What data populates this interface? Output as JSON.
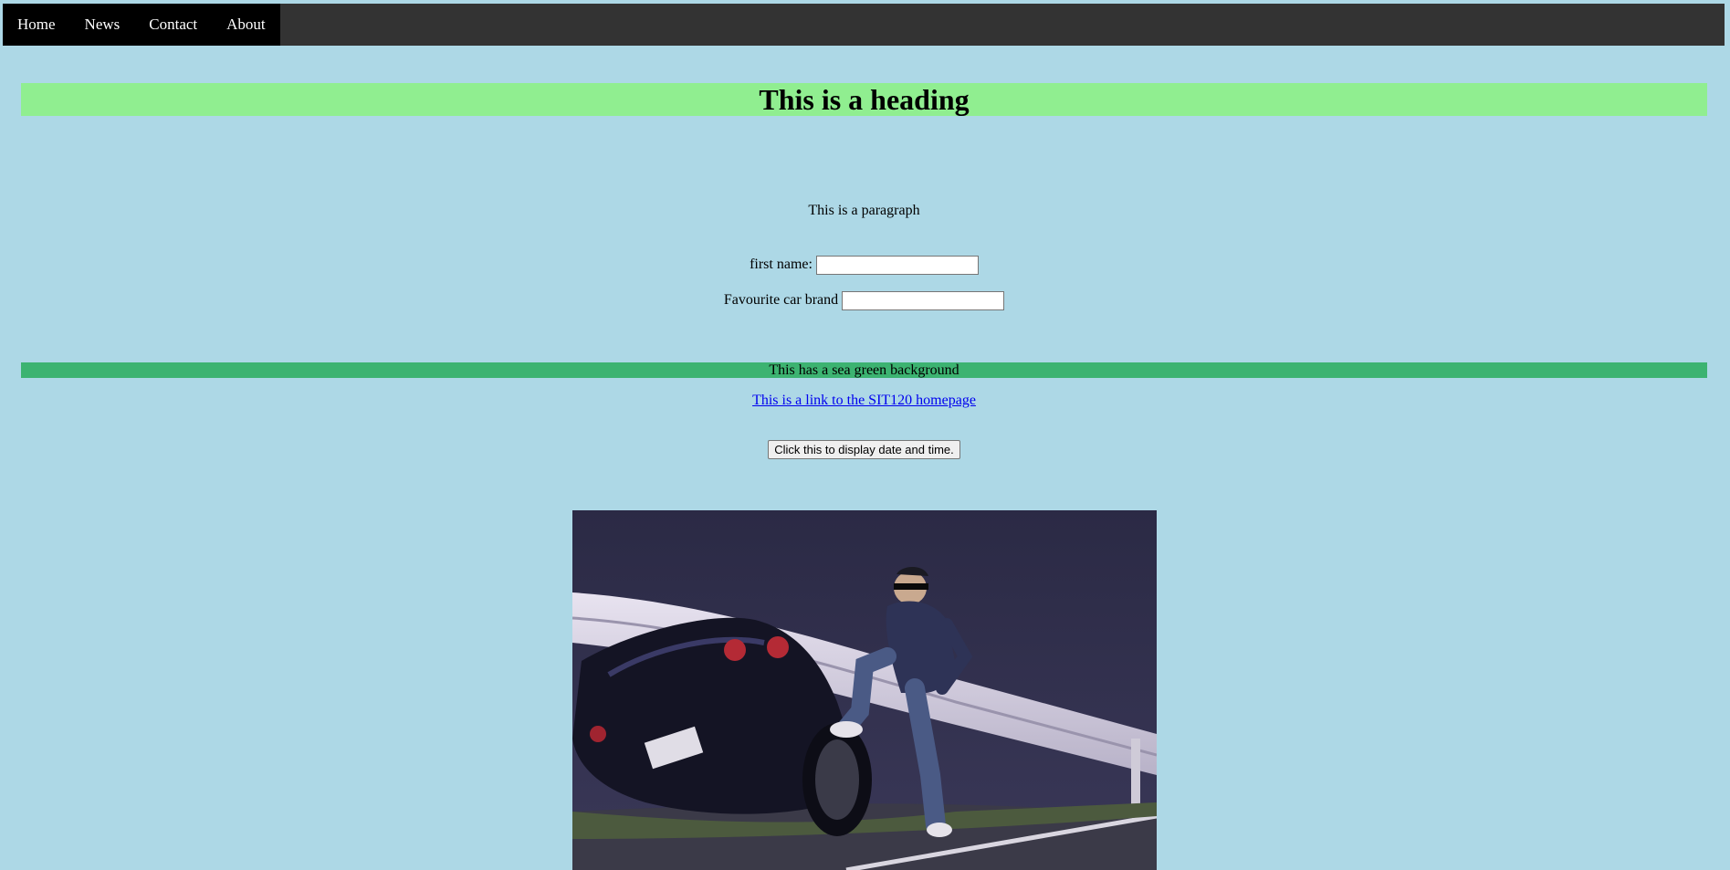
{
  "nav": {
    "items": [
      {
        "label": "Home"
      },
      {
        "label": "News"
      },
      {
        "label": "Contact"
      },
      {
        "label": "About"
      }
    ]
  },
  "main": {
    "heading": "This is a heading",
    "paragraph": "This is a paragraph",
    "form": {
      "first_name_label": "first name:",
      "first_name_value": "",
      "car_brand_label": "Favourite car brand",
      "car_brand_value": ""
    },
    "sea_green_text": "This has a sea green background",
    "link_text": "This is a link to the SIT120 homepage",
    "button_label": "Click this to display date and time."
  },
  "colors": {
    "page_background": "#add8e6",
    "nav_background": "#333333",
    "nav_active_background": "#000000",
    "heading_background": "#90ee90",
    "sea_green": "#3cb371",
    "link": "#0000ee"
  }
}
